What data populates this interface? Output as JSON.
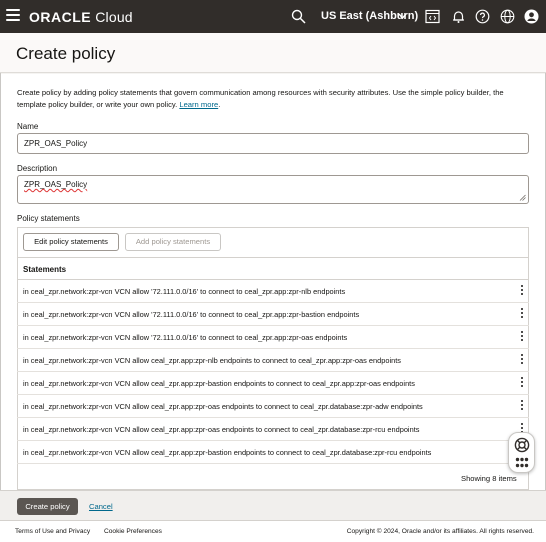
{
  "topbar": {
    "brand_bold": "ORACLE",
    "brand_rest": " Cloud",
    "region": "US East (Ashburn)",
    "icons": [
      "menu-icon",
      "search-icon",
      "chevron-down-icon",
      "code-editor-icon",
      "notifications-icon",
      "help-icon",
      "language-icon",
      "profile-icon"
    ]
  },
  "page": {
    "title": "Create policy",
    "intro_text": "Create policy by adding policy statements that govern communication among resources with security attributes. Use the simple policy builder, the template policy builder, or write your own policy. ",
    "learn_more": "Learn more",
    "name_label": "Name",
    "name_value": "ZPR_OAS_Policy",
    "description_label": "Description",
    "description_value": "ZPR_OAS_Policy",
    "statements_label": "Policy statements"
  },
  "statements": {
    "edit_button": "Edit policy statements",
    "add_button": "Add policy statements",
    "column_header": "Statements",
    "rows": [
      "in ceal_zpr.network:zpr-vcn VCN allow '72.111.0.0/16' to connect to ceal_zpr.app:zpr-nlb endpoints",
      "in ceal_zpr.network:zpr-vcn VCN allow '72.111.0.0/16' to connect to ceal_zpr.app:zpr-bastion endpoints",
      "in ceal_zpr.network:zpr-vcn VCN allow '72.111.0.0/16' to connect to ceal_zpr.app:zpr-oas endpoints",
      "in ceal_zpr.network:zpr-vcn VCN allow ceal_zpr.app:zpr-nlb endpoints to connect to ceal_zpr.app:zpr-oas endpoints",
      "in ceal_zpr.network:zpr-vcn VCN allow ceal_zpr.app:zpr-bastion endpoints to connect to ceal_zpr.app:zpr-oas endpoints",
      "in ceal_zpr.network:zpr-vcn VCN allow ceal_zpr.app:zpr-oas endpoints to connect to ceal_zpr.database:zpr-adw endpoints",
      "in ceal_zpr.network:zpr-vcn VCN allow ceal_zpr.app:zpr-oas endpoints to connect to ceal_zpr.database:zpr-rcu endpoints",
      "in ceal_zpr.network:zpr-vcn VCN allow ceal_zpr.app:zpr-bastion endpoints to connect to ceal_zpr.database:zpr-rcu endpoints"
    ],
    "showing": "Showing 8 items"
  },
  "actions": {
    "create_button": "Create policy",
    "cancel_link": "Cancel"
  },
  "footer": {
    "terms": "Terms of Use and Privacy",
    "cookies": "Cookie Preferences",
    "copyright": "Copyright © 2024, Oracle and/or its affiliates. All rights reserved."
  },
  "colors": {
    "topbar": "#312d2a",
    "link": "#00688c",
    "primary_button": "#5b5652"
  }
}
